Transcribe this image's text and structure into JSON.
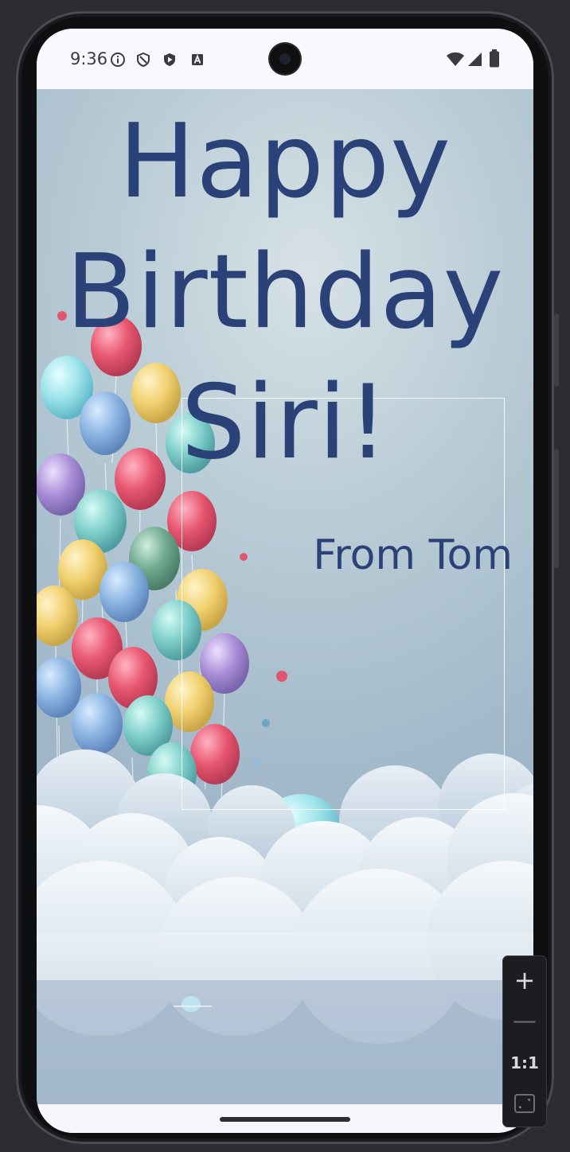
{
  "status_bar": {
    "time": "9:36",
    "left_icons": [
      "info-icon",
      "shield-icon",
      "play-protect-icon",
      "a-icon"
    ],
    "right_icons": [
      "wifi-icon",
      "signal-icon",
      "battery-icon"
    ]
  },
  "card": {
    "title_lines": [
      "Happy",
      "Birthday",
      "Siri!"
    ],
    "signature": "From Tom",
    "text_color": "#2b4278"
  },
  "zoom_controls": {
    "zoom_in": "+",
    "zoom_out": "—",
    "actual_size": "1:1",
    "fit_icon": "fit-screen-icon"
  },
  "colors": {
    "status_bar_bg": "#f8f8fd",
    "sky": "#b9ccd6"
  }
}
